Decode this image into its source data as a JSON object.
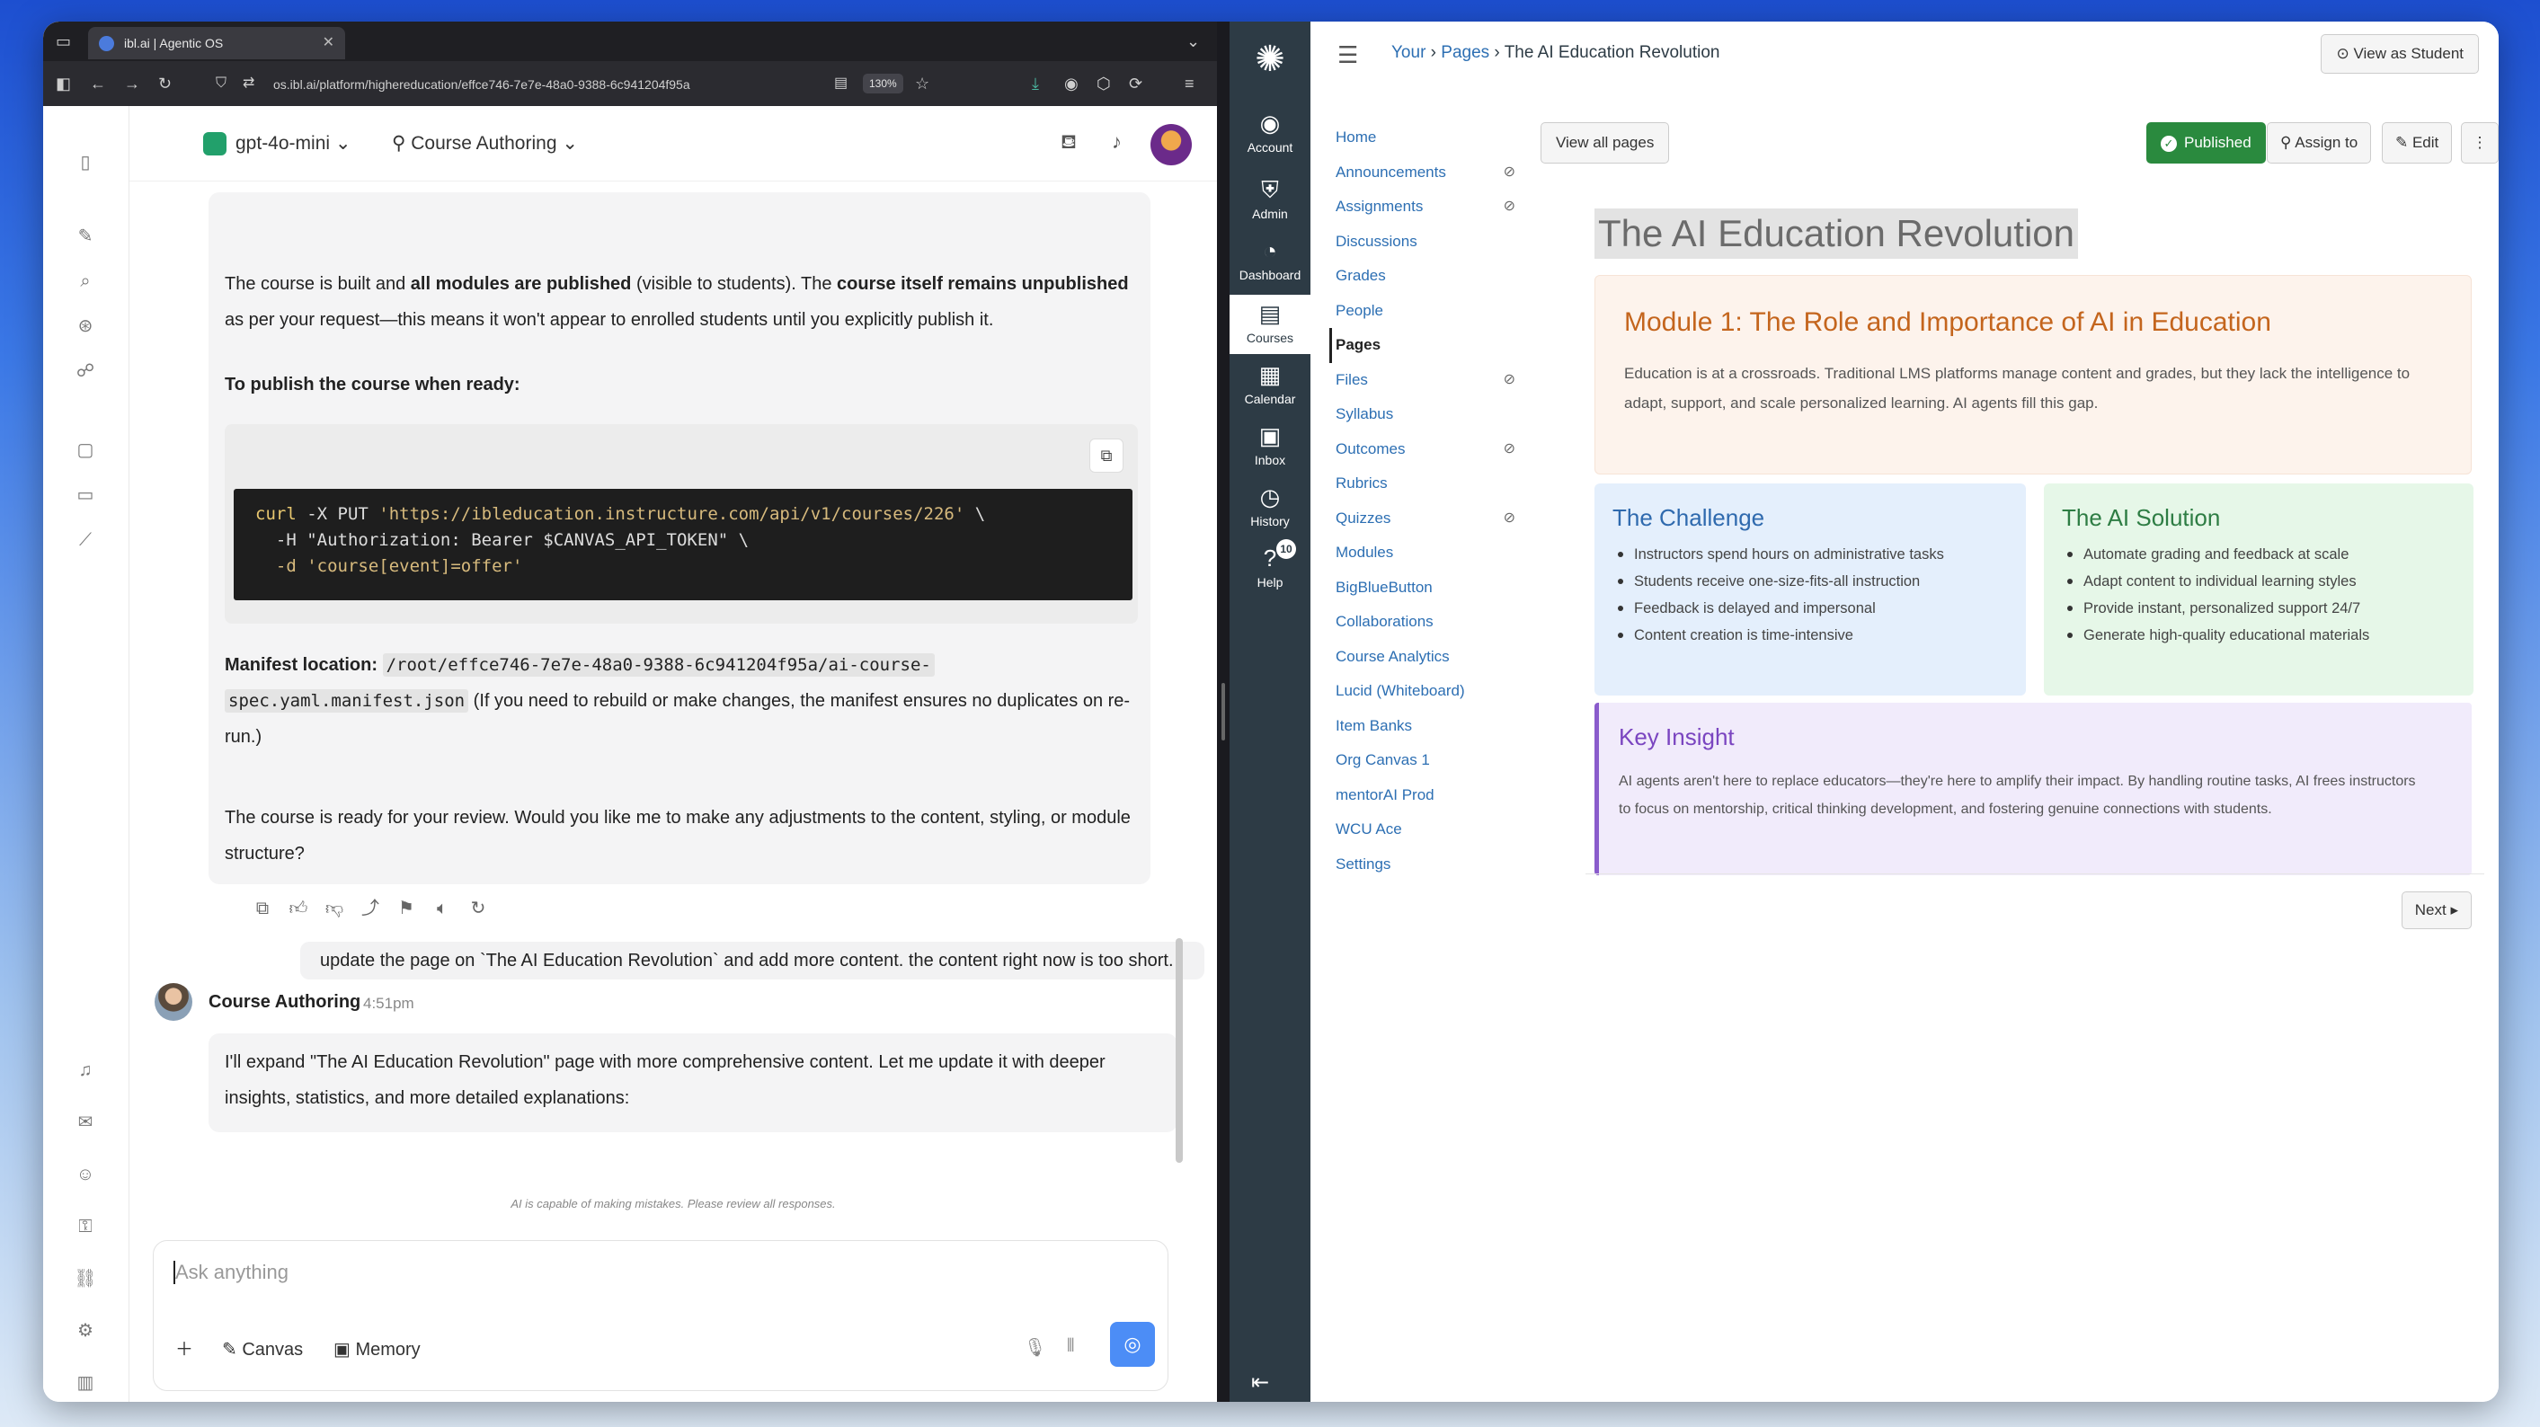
{
  "browser": {
    "tab_title": "ibl.ai | Agentic OS",
    "url": "os.ibl.ai/platform/highereducation/effce746-7e7e-48a0-9388-6c941204f95a",
    "zoom": "130%"
  },
  "chat": {
    "model": "gpt-4o-mini",
    "persona": "Course Authoring",
    "assistant_block": {
      "p1_a": "The course is built and ",
      "p1_b": "all modules are published",
      "p1_c": " (visible to students). The ",
      "p1_d": "course itself remains unpublished",
      "p1_e": " as per your request—this means it won't appear to enrolled students until you explicitly publish it.",
      "p2": "To publish the course when ready:",
      "code_l1_cmd": "curl",
      "code_l1_rest": " -X PUT ",
      "code_l1_str": "'https://ibleducation.instructure.com/api/v1/courses/226'",
      "code_l1_tail": " \\",
      "code_l2": "  -H \"Authorization: Bearer $CANVAS_API_TOKEN\" \\",
      "code_l3": "  -d 'course[event]=offer'",
      "manifest_label": "Manifest location:",
      "manifest_path_1": "/root/effce746-7e7e-48a0-9388-6c941204f95a/ai-course-",
      "manifest_path_2": "spec.yaml.manifest.json",
      "manifest_note": " (If you need to rebuild or make changes, the manifest ensures no duplicates on re-run.)",
      "p4": "The course is ready for your review. Would you like me to make any adjustments to the content, styling, or module structure?"
    },
    "user_message": "update the page on `The AI Education Revolution` and add more content. the content right now is too short.",
    "bot_name": "Course Authoring",
    "bot_time": "4:51pm",
    "bot_message": "I'll expand \"The AI Education Revolution\" page with more comprehensive content. Let me update it with deeper insights, statistics, and more detailed explanations:",
    "disclaimer": "AI is capable of making mistakes. Please review all responses.",
    "input_placeholder": "Ask anything",
    "canvas_label": "Canvas",
    "memory_label": "Memory"
  },
  "canvas_nav": {
    "items": [
      {
        "label": "Account",
        "icon": "account-icon"
      },
      {
        "label": "Admin",
        "icon": "admin-icon"
      },
      {
        "label": "Dashboard",
        "icon": "dashboard-icon"
      },
      {
        "label": "Courses",
        "icon": "courses-icon"
      },
      {
        "label": "Calendar",
        "icon": "calendar-icon"
      },
      {
        "label": "Inbox",
        "icon": "inbox-icon"
      },
      {
        "label": "History",
        "icon": "history-icon"
      },
      {
        "label": "Help",
        "icon": "help-icon"
      }
    ],
    "help_badge": "10"
  },
  "canvas": {
    "breadcrumb": [
      "Your",
      "Pages",
      "The AI Education Revolution"
    ],
    "view_as_student": "View as Student",
    "course_nav": [
      "Home",
      "Announcements",
      "Assignments",
      "Discussions",
      "Grades",
      "People",
      "Pages",
      "Files",
      "Syllabus",
      "Outcomes",
      "Rubrics",
      "Quizzes",
      "Modules",
      "BigBlueButton",
      "Collaborations",
      "Course Analytics",
      "Lucid (Whiteboard)",
      "Item Banks",
      "Org Canvas 1",
      "mentorAI Prod",
      "WCU Ace",
      "Settings"
    ],
    "view_all_pages": "View all pages",
    "published": "Published",
    "assign_to": "Assign to",
    "edit": "Edit",
    "page_title": "The AI Education Revolution",
    "module_title": "Module 1: The Role and Importance of AI in Education",
    "module_text": "Education is at a crossroads. Traditional LMS platforms manage content and grades, but they lack the intelligence to adapt, support, and scale personalized learning. AI agents fill this gap.",
    "challenge_title": "The Challenge",
    "challenge_items": [
      "Instructors spend hours on administrative tasks",
      "Students receive one-size-fits-all instruction",
      "Feedback is delayed and impersonal",
      "Content creation is time-intensive"
    ],
    "solution_title": "The AI Solution",
    "solution_items": [
      "Automate grading and feedback at scale",
      "Adapt content to individual learning styles",
      "Provide instant, personalized support 24/7",
      "Generate high-quality educational materials"
    ],
    "insight_title": "Key Insight",
    "insight_text": "AI agents aren't here to replace educators—they're here to amplify their impact. By handling routine tasks, AI frees instructors to focus on mentorship, critical thinking development, and fostering genuine connections with students.",
    "next": "Next ▸"
  },
  "colors": {
    "canvas_nav": "#2d3b45",
    "published": "#2a8a3e",
    "module_bg": "#fdf3ec",
    "challenge_bg": "#e4effc",
    "solution_bg": "#e6f7e8",
    "insight_bg": "#f1ebfb"
  }
}
